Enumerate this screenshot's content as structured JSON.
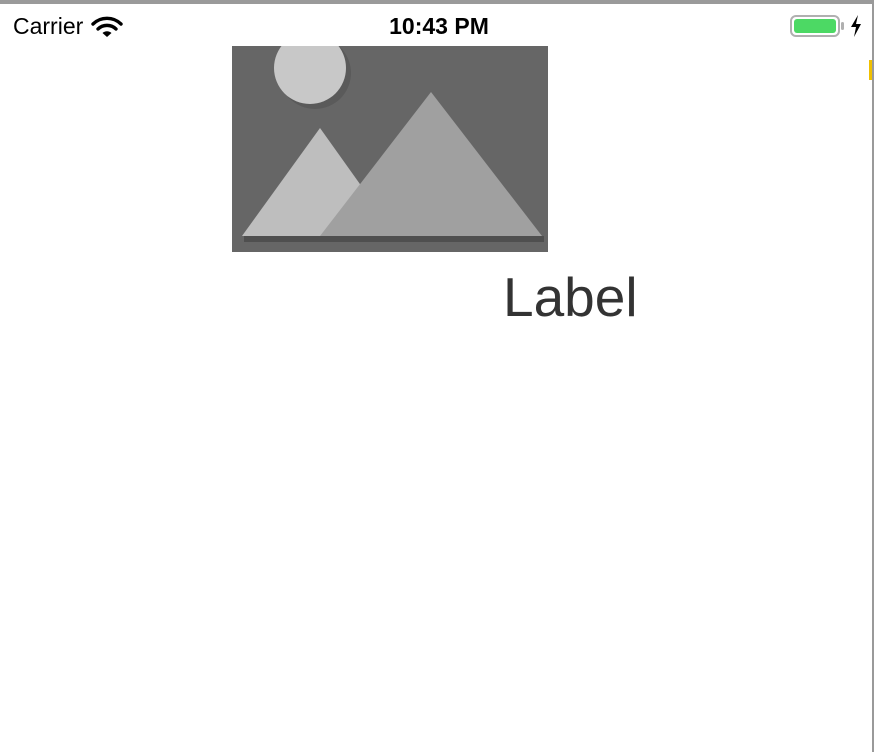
{
  "status_bar": {
    "carrier": "Carrier",
    "time": "10:43 PM",
    "wifi_icon": "wifi-icon",
    "battery_icon": "battery-icon",
    "charging_icon": "bolt-icon",
    "battery_color": "#4cd964"
  },
  "content": {
    "image_placeholder_icon": "image-placeholder-icon",
    "label": "Label"
  }
}
